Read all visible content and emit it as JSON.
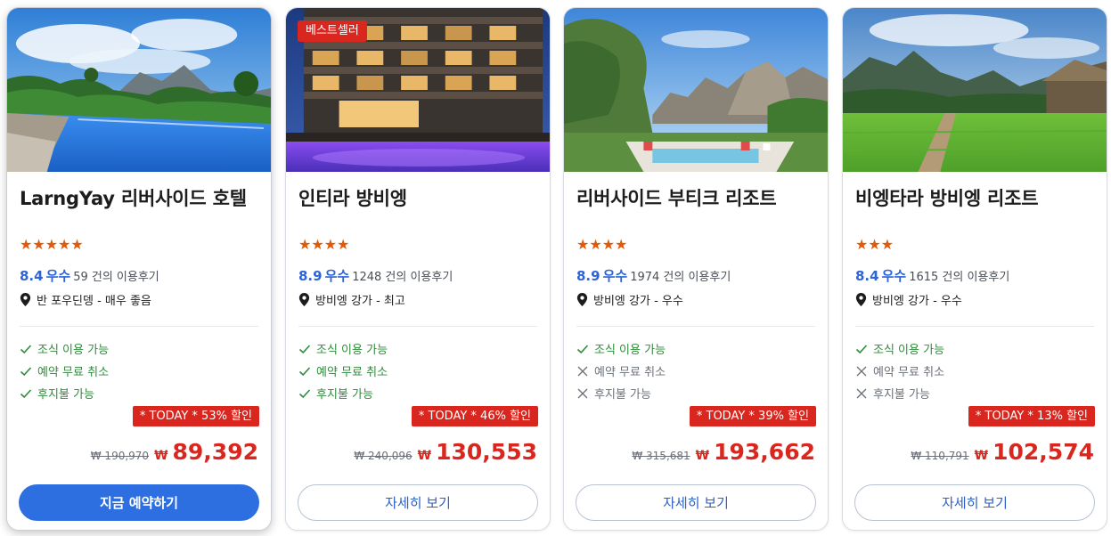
{
  "cards": [
    {
      "badge": "",
      "name": "LarngYay 리버사이드 호텔",
      "stars": "★★★★★",
      "star_count": 5,
      "score": "8.4",
      "word": "우수",
      "reviews": "59 건의 이용후기",
      "location": "반 포우딘뎅 - 매우 좋음",
      "features": [
        {
          "label": "조식 이용 가능",
          "available": true
        },
        {
          "label": "예약 무료 취소",
          "available": true
        },
        {
          "label": "후지불 가능",
          "available": true
        }
      ],
      "discount": "* TODAY * 53% 할인",
      "original_price": "₩ 190,970",
      "currency": "₩",
      "price": "89,392",
      "button": "지금 예약하기",
      "button_style": "primary"
    },
    {
      "badge": "베스트셀러",
      "name": "인티라 방비엥",
      "stars": "★★★★",
      "star_count": 4,
      "score": "8.9",
      "word": "우수",
      "reviews": "1248 건의 이용후기",
      "location": "방비엥 강가 - 최고",
      "features": [
        {
          "label": "조식 이용 가능",
          "available": true
        },
        {
          "label": "예약 무료 취소",
          "available": true
        },
        {
          "label": "후지불 가능",
          "available": true
        }
      ],
      "discount": "* TODAY * 46% 할인",
      "original_price": "₩ 240,096",
      "currency": "₩",
      "price": "130,553",
      "button": "자세히 보기",
      "button_style": "outline"
    },
    {
      "badge": "",
      "name": "리버사이드 부티크 리조트",
      "stars": "★★★★",
      "star_count": 4,
      "score": "8.9",
      "word": "우수",
      "reviews": "1974 건의 이용후기",
      "location": "방비엥 강가 - 우수",
      "features": [
        {
          "label": "조식 이용 가능",
          "available": true
        },
        {
          "label": "예약 무료 취소",
          "available": false
        },
        {
          "label": "후지불 가능",
          "available": false
        }
      ],
      "discount": "* TODAY * 39% 할인",
      "original_price": "₩ 315,681",
      "currency": "₩",
      "price": "193,662",
      "button": "자세히 보기",
      "button_style": "outline"
    },
    {
      "badge": "",
      "name": "비엥타라 방비엥 리조트",
      "stars": "★★★",
      "star_count": 3,
      "score": "8.4",
      "word": "우수",
      "reviews": "1615 건의 이용후기",
      "location": "방비엥 강가 - 우수",
      "features": [
        {
          "label": "조식 이용 가능",
          "available": true
        },
        {
          "label": "예약 무료 취소",
          "available": false
        },
        {
          "label": "후지불 가능",
          "available": false
        }
      ],
      "discount": "* TODAY * 13% 할인",
      "original_price": "₩ 110,791",
      "currency": "₩",
      "price": "102,574",
      "button": "자세히 보기",
      "button_style": "outline"
    }
  ],
  "colors": {
    "accent_blue": "#2d6fe0",
    "sale_red": "#d9271f",
    "star_orange": "#e15a0a",
    "check_green": "#2e8b3a"
  },
  "icons": {
    "location": "map-pin-icon",
    "available": "check-icon",
    "unavailable": "cross-icon"
  }
}
